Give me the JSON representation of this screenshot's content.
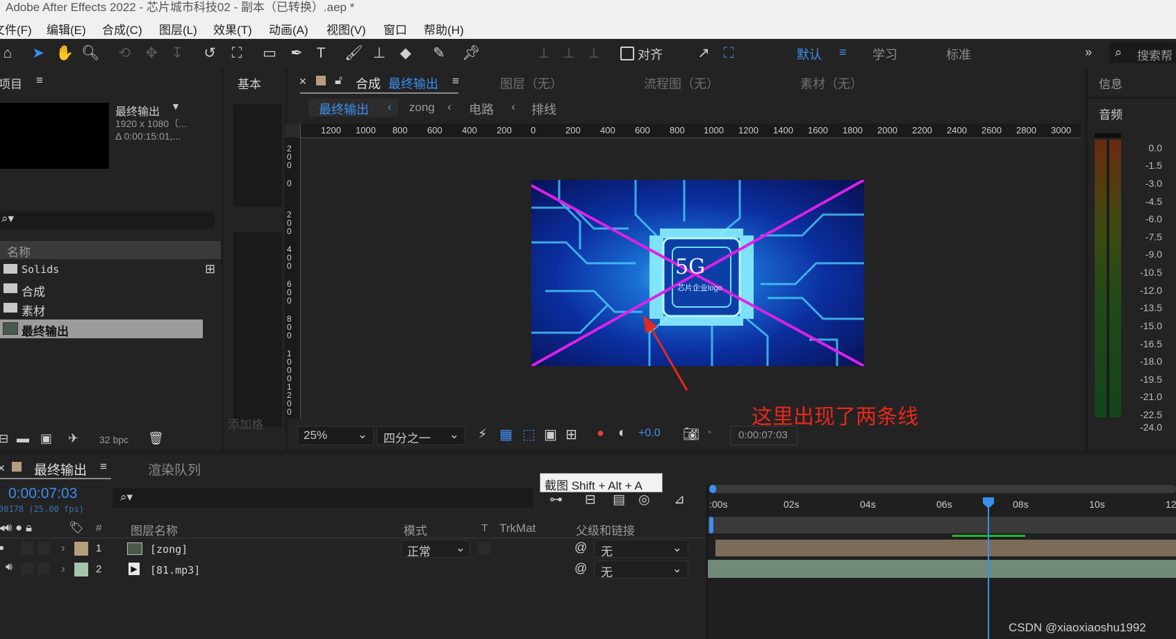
{
  "window": {
    "title": "Adobe After Effects 2022 - 芯片城市科技02 - 副本（已转换）.aep *"
  },
  "menu": [
    "文件(F)",
    "编辑(E)",
    "合成(C)",
    "图层(L)",
    "效果(T)",
    "动画(A)",
    "视图(V)",
    "窗口",
    "帮助(H)"
  ],
  "toolbar": {
    "align_label": "对齐",
    "workspaces": [
      "默认",
      "学习",
      "标准"
    ],
    "search_placeholder": "搜索帮"
  },
  "project_panel": {
    "title": "项目",
    "comp_name": "最终输出",
    "comp_size": "1920 x 1080（...",
    "comp_duration": "Δ 0:00:15:01,...",
    "column_name": "名称",
    "items": [
      "Solids",
      "合成",
      "素材",
      "最终输出"
    ],
    "bpc": "32 bpc"
  },
  "effects_panel": {
    "title": "基本",
    "add_label": "添加格"
  },
  "composition_panel": {
    "tab_prefix": "合成",
    "tab_name": "最终输出",
    "other_tabs": [
      "图层（无）",
      "流程图（无）",
      "素材（无）"
    ],
    "breadcrumbs": [
      "最终输出",
      "zong",
      "电路",
      "排线"
    ],
    "ruler_labels": [
      "1200",
      "1000",
      "800",
      "600",
      "400",
      "200",
      "0",
      "200",
      "400",
      "600",
      "800",
      "1000",
      "1200",
      "1400",
      "1600",
      "1800",
      "2000",
      "2200",
      "2400",
      "2600",
      "2800",
      "3000"
    ],
    "v_ruler_labels": [
      "200",
      "0",
      "200",
      "400",
      "600",
      "800",
      "1000",
      "1200"
    ],
    "preview_text": "5G",
    "preview_subtext": "芯片企业logo",
    "annotation": "这里出现了两条线",
    "zoom": "25%",
    "resolution": "四分之一",
    "exposure": "+0.0",
    "timecode": "0:00:07:03"
  },
  "info_panel": {
    "title": "信息",
    "audio_title": "音频",
    "meter_labels": [
      "0.0",
      "-1.5",
      "-3.0",
      "-4.5",
      "-6.0",
      "-7.5",
      "-9.0",
      "-10.5",
      "-12.0",
      "-13.5",
      "-15.0",
      "-16.5",
      "-18.0",
      "-19.5",
      "-21.0",
      "-22.5",
      "-24.0"
    ]
  },
  "timeline": {
    "tab_name": "最终输出",
    "render_queue": "渲染队列",
    "timecode": "0:00:07:03",
    "frame_info": "00178 (25.00 fps)",
    "tooltip": "截图 Shift + Alt + A",
    "columns": {
      "hash": "#",
      "layer_name": "图层名称",
      "mode": "模式",
      "t": "T",
      "trkmat": "TrkMat",
      "parent": "父级和链接"
    },
    "layers": [
      {
        "num": "1",
        "name": "[zong]",
        "mode": "正常",
        "parent": "无",
        "color": "#b59e7e"
      },
      {
        "num": "2",
        "name": "[81.mp3]",
        "mode": "",
        "parent": "无",
        "color": "#a7c2ad"
      }
    ],
    "time_ticks": [
      ":00s",
      "02s",
      "04s",
      "06s",
      "08s",
      "10s",
      "12"
    ],
    "playhead_seconds": 7.12,
    "watermark": "CSDN @xiaoxiaoshu1992"
  },
  "colors": {
    "accent": "#3c8ef0",
    "annotation": "#e8281c",
    "panel": "#232323",
    "background": "#1d1d1d"
  }
}
